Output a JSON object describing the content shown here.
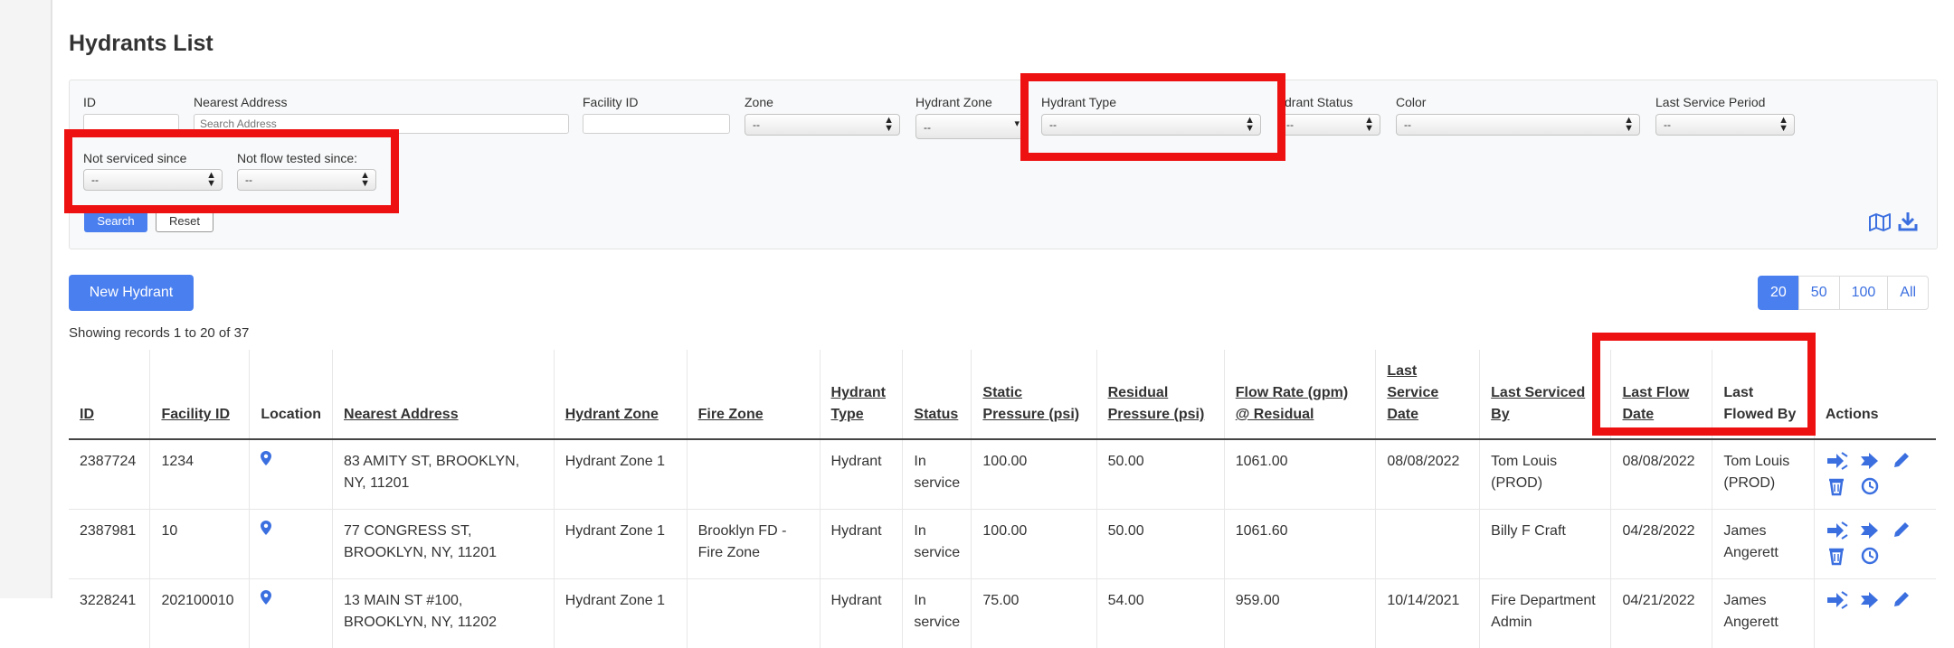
{
  "page": {
    "title": "Hydrants List"
  },
  "filters": {
    "id": {
      "label": "ID",
      "value": ""
    },
    "nearest_address": {
      "label": "Nearest Address",
      "placeholder": "Search Address"
    },
    "facility_id": {
      "label": "Facility ID",
      "value": ""
    },
    "zone": {
      "label": "Zone",
      "value": "--"
    },
    "hydrant_zone": {
      "label": "Hydrant Zone",
      "value": "--"
    },
    "hydrant_type": {
      "label": "Hydrant Type",
      "value": "--"
    },
    "hydrant_status": {
      "label": "ydrant Status",
      "value": "--"
    },
    "color": {
      "label": "Color",
      "value": "--"
    },
    "last_service_period": {
      "label": "Last Service Period",
      "value": "--"
    },
    "not_serviced_since": {
      "label": "Not serviced since",
      "value": "--"
    },
    "not_flow_tested_since": {
      "label": "Not flow tested since:",
      "value": "--"
    },
    "search_label": "Search",
    "reset_label": "Reset"
  },
  "toolbar": {
    "new_hydrant_label": "New Hydrant"
  },
  "pagination": {
    "sizes": [
      "20",
      "50",
      "100",
      "All"
    ],
    "active": "20"
  },
  "records_text": "Showing records 1 to 20 of 37",
  "table": {
    "headers": {
      "id": "ID",
      "facility_id": "Facility ID",
      "location": "Location",
      "nearest_address": "Nearest Address",
      "hydrant_zone": "Hydrant Zone",
      "fire_zone": "Fire Zone",
      "hydrant_type": "Hydrant Type",
      "status": "Status",
      "static_pressure": "Static Pressure (psi)",
      "residual_pressure": "Residual Pressure (psi)",
      "flow_rate": "Flow Rate (gpm) @ Residual",
      "last_service_date": "Last Service Date",
      "last_serviced_by": "Last Serviced By",
      "last_flow_date": "Last Flow Date",
      "last_flowed_by": "Last Flowed By",
      "actions": "Actions"
    },
    "rows": [
      {
        "id": "2387724",
        "facility_id": "1234",
        "nearest_address": "83 AMITY ST, BROOKLYN, NY, 11201",
        "hydrant_zone": "Hydrant Zone 1",
        "fire_zone": "",
        "hydrant_type": "Hydrant",
        "status": "In service",
        "static_pressure": "100.00",
        "residual_pressure": "50.00",
        "flow_rate": "1061.00",
        "last_service_date": "08/08/2022",
        "last_serviced_by": "Tom Louis (PROD)",
        "last_flow_date": "08/08/2022",
        "last_flowed_by": "Tom Louis (PROD)"
      },
      {
        "id": "2387981",
        "facility_id": "10",
        "nearest_address": "77 CONGRESS ST, BROOKLYN, NY, 11201",
        "hydrant_zone": "Hydrant Zone 1",
        "fire_zone": "Brooklyn FD - Fire Zone",
        "hydrant_type": "Hydrant",
        "status": "In service",
        "static_pressure": "100.00",
        "residual_pressure": "50.00",
        "flow_rate": "1061.60",
        "last_service_date": "",
        "last_serviced_by": "Billy F Craft",
        "last_flow_date": "04/28/2022",
        "last_flowed_by": "James Angerett"
      },
      {
        "id": "3228241",
        "facility_id": "202100010",
        "nearest_address": "13 MAIN ST #100, BROOKLYN, NY, 11202",
        "hydrant_zone": "Hydrant Zone 1",
        "fire_zone": "",
        "hydrant_type": "Hydrant",
        "status": "In service",
        "static_pressure": "75.00",
        "residual_pressure": "54.00",
        "flow_rate": "959.00",
        "last_service_date": "10/14/2021",
        "last_serviced_by": "Fire Department Admin",
        "last_flow_date": "04/21/2022",
        "last_flowed_by": "James Angerett"
      }
    ]
  },
  "colors": {
    "primary": "#4a7fef",
    "highlight": "#ee1111",
    "action_icon": "#3b6fe0"
  },
  "icons": {
    "location": "map-pin-icon",
    "map": "map-icon",
    "download": "download-icon",
    "actions": [
      "service-icon",
      "flow-test-icon",
      "edit-icon",
      "delete-icon",
      "history-icon"
    ]
  }
}
